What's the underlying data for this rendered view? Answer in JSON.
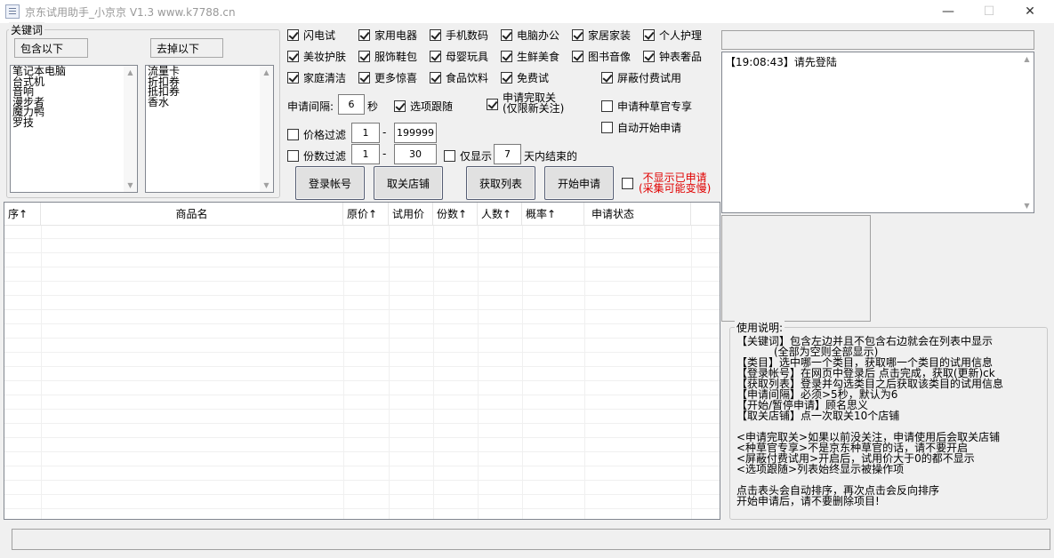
{
  "window": {
    "title": "京东试用助手_小京京 V1.3 www.k7788.cn",
    "controls": {
      "minimize": "—",
      "maximize": "☐",
      "close": "✕"
    }
  },
  "keywords": {
    "group_label": "关键词",
    "include_label": "包含以下",
    "exclude_label": "去掉以下",
    "include_items": [
      "笔记本电脑",
      "台式机",
      "音响",
      "漫步者",
      "魔力鸭",
      "罗技"
    ],
    "exclude_items": [
      "流量卡",
      "折扣券",
      "抵扣券",
      "香水"
    ]
  },
  "categories": [
    {
      "label": "闪电试",
      "checked": true
    },
    {
      "label": "家用电器",
      "checked": true
    },
    {
      "label": "手机数码",
      "checked": true
    },
    {
      "label": "电脑办公",
      "checked": true
    },
    {
      "label": "家居家装",
      "checked": true
    },
    {
      "label": "个人护理",
      "checked": true
    },
    {
      "label": "美妆护肤",
      "checked": true
    },
    {
      "label": "服饰鞋包",
      "checked": true
    },
    {
      "label": "母婴玩具",
      "checked": true
    },
    {
      "label": "生鲜美食",
      "checked": true
    },
    {
      "label": "图书音像",
      "checked": true
    },
    {
      "label": "钟表奢品",
      "checked": true
    },
    {
      "label": "家庭清洁",
      "checked": true
    },
    {
      "label": "更多惊喜",
      "checked": true
    },
    {
      "label": "食品饮料",
      "checked": true
    },
    {
      "label": "免费试",
      "checked": true
    },
    {
      "label": "屏蔽付费试用",
      "checked": true
    }
  ],
  "options": {
    "interval_label": "申请间隔:",
    "interval_value": "6",
    "interval_unit": "秒",
    "follow_selected": {
      "label": "选项跟随",
      "checked": true
    },
    "unfollow": {
      "label_line1": "申请完取关",
      "label_line2": "(仅限新关注)",
      "checked": true
    },
    "grass_official": {
      "label": "申请种草官专享",
      "checked": false
    },
    "auto_start": {
      "label": "自动开始申请",
      "checked": false
    },
    "price_filter": {
      "label": "价格过滤",
      "checked": false,
      "min": "1",
      "max": "199999",
      "sep": "-"
    },
    "count_filter": {
      "label": "份数过滤",
      "checked": false,
      "min": "1",
      "max": "30",
      "sep": "-"
    },
    "days_filter": {
      "label": "仅显示",
      "checked": false,
      "value": "7",
      "suffix": "天内结束的"
    },
    "hide_applied": {
      "label_line1": "不显示已申请",
      "label_line2": "(采集可能变慢)",
      "checked": false
    }
  },
  "buttons": {
    "login": "登录帐号",
    "unfollow_shops": "取关店铺",
    "fetch_list": "获取列表",
    "start_apply": "开始申请"
  },
  "table": {
    "columns": [
      "序↑",
      "商品名",
      "原价↑",
      "试用价",
      "份数↑",
      "人数↑",
      "概率↑",
      "申请状态"
    ]
  },
  "log": {
    "lines": [
      "【19:08:43】请先登陆"
    ]
  },
  "help": {
    "title": "使用说明:",
    "text": "【关键词】包含左边并且不包含右边就会在列表中显示\n           (全部为空则全部显示)\n【类目】选中哪一个类目，获取哪一个类目的试用信息\n【登录帐号】在网页中登录后 点击完成，获取(更新)ck\n【获取列表】登录并勾选类目之后获取该类目的试用信息\n【申请间隔】必须>5秒，默认为6\n【开始/暂停申请】顾名思义\n【取关店铺】点一次取关10个店铺\n\n<申请完取关>如果以前没关注，申请使用后会取关店铺\n<种草官专享>不是京东种草官的话，请不要开启\n<屏蔽付费试用>开启后，试用价大于0的都不显示\n<选项跟随>列表始终显示被操作项\n\n点击表头会自动排序，再次点击会反向排序\n开始申请后，请不要删除项目!"
  },
  "colors": {
    "window_bg": "#f0f0f0",
    "hide_applied_text": "#e00000"
  }
}
